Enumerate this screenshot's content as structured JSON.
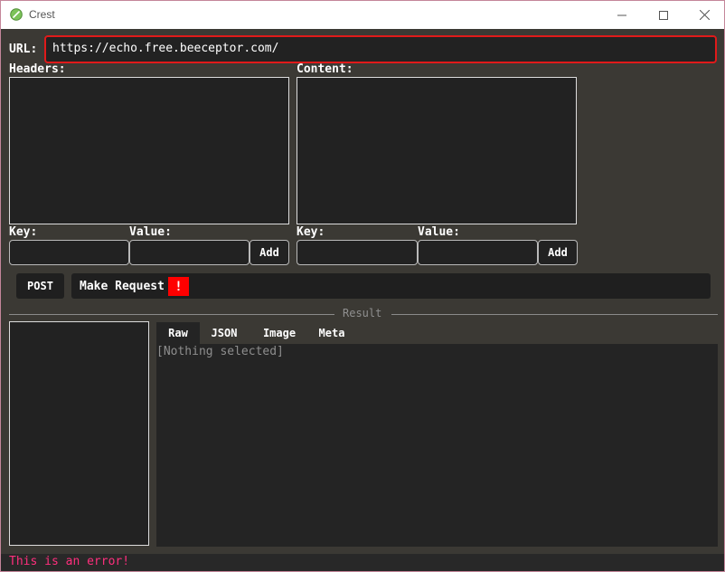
{
  "window": {
    "title": "Crest"
  },
  "request": {
    "url_label": "URL:",
    "url_value": "https://echo.free.beeceptor.com/",
    "headers_label": "Headers:",
    "content_label": "Content:",
    "headers_key_label": "Key:",
    "headers_value_label": "Value:",
    "headers_add_label": "Add",
    "content_key_label": "Key:",
    "content_value_label": "Value:",
    "content_add_label": "Add",
    "method_label": "POST",
    "make_request_label": "Make Request",
    "error_badge": "!"
  },
  "result": {
    "section_label": "Result",
    "tabs": [
      {
        "label": "Raw",
        "active": true
      },
      {
        "label": "JSON",
        "active": false
      },
      {
        "label": "Image",
        "active": false
      },
      {
        "label": "Meta",
        "active": false
      }
    ],
    "placeholder": "[Nothing selected]"
  },
  "status": {
    "error_message": "This is an error!"
  },
  "colors": {
    "background": "#3b3934",
    "panel": "#222222",
    "url_border": "#e01a1a",
    "error_badge": "#ff0000",
    "error_text": "#ff2f7d"
  }
}
